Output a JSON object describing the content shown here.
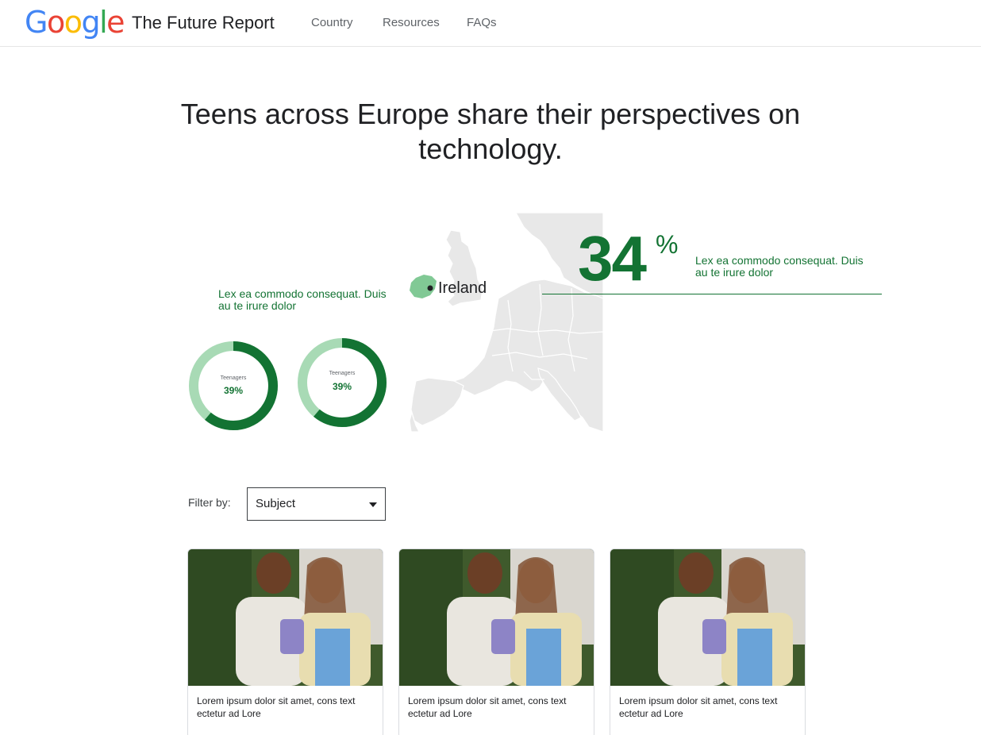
{
  "header": {
    "logo": [
      "G",
      "o",
      "o",
      "g",
      "l",
      "e"
    ],
    "logo_colors": [
      "#4285F4",
      "#EA4335",
      "#FBBC05",
      "#4285F4",
      "#34A853",
      "#EA4335"
    ],
    "title": "The Future Report",
    "nav": {
      "country": "Country",
      "resources": "Resources",
      "faqs": "FAQs"
    }
  },
  "hero": {
    "title": "Teens across Europe share their perspectives on technology."
  },
  "map": {
    "country_label": "Ireland",
    "highlight_color": "#81c995",
    "land_color": "#e8e8e8"
  },
  "stat": {
    "value": "34",
    "unit": "%",
    "description": "Lex ea commodo consequat. Duis au te irure dolor"
  },
  "donut_section": {
    "description": "Lex ea commodo consequat. Duis au te irure dolor",
    "donuts": [
      {
        "label": "Teenagers",
        "value_text": "39%",
        "fraction": 0.39
      },
      {
        "label": "Teenagers",
        "value_text": "39%",
        "fraction": 0.39
      }
    ]
  },
  "filter": {
    "label": "Filter by:",
    "selected": "Subject"
  },
  "cards": [
    {
      "caption": "Lorem ipsum dolor sit amet, cons text ectetur ad Lore"
    },
    {
      "caption": "Lorem ipsum dolor sit amet, cons text ectetur ad Lore"
    },
    {
      "caption": "Lorem ipsum dolor sit amet, cons text ectetur ad Lore"
    }
  ],
  "colors": {
    "accent": "#137333",
    "donut_light": "#a8dab5",
    "donut_dark": "#137333"
  }
}
